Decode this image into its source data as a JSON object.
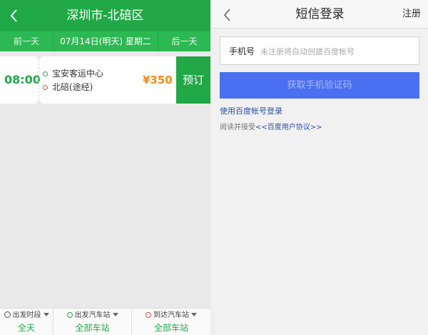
{
  "left": {
    "title": "深圳市-北碚区",
    "date_bar": {
      "prev": "前一天",
      "date": "07月14日(明天) 星期二",
      "next": "后一天"
    },
    "trip": {
      "time": "08:00",
      "from": "宝安客运中心",
      "to": "北碚(途经)",
      "price": "¥350",
      "book_label": "预订"
    },
    "filters": [
      {
        "label": "出发时段",
        "value": "全天",
        "icon": "clock-icon"
      },
      {
        "label": "出发汽车站",
        "value": "全部车站",
        "icon": "origin-dot-icon"
      },
      {
        "label": "到达汽车站",
        "value": "全部车站",
        "icon": "destination-dot-icon"
      }
    ],
    "colors": {
      "brand": "#21a846",
      "price": "#f08c1c"
    }
  },
  "right": {
    "title": "短信登录",
    "register": "注册",
    "phone": {
      "label": "手机号",
      "placeholder": "未注册将自动创建百度帐号",
      "value": ""
    },
    "get_code": "获取手机验证码",
    "use_baidu_account": "使用百度帐号登录",
    "agreement": {
      "prefix": "阅读并接受",
      "link": "<<百度用户协议>>"
    },
    "colors": {
      "button": "#4a6ff0",
      "link": "#2e4fa8"
    }
  }
}
